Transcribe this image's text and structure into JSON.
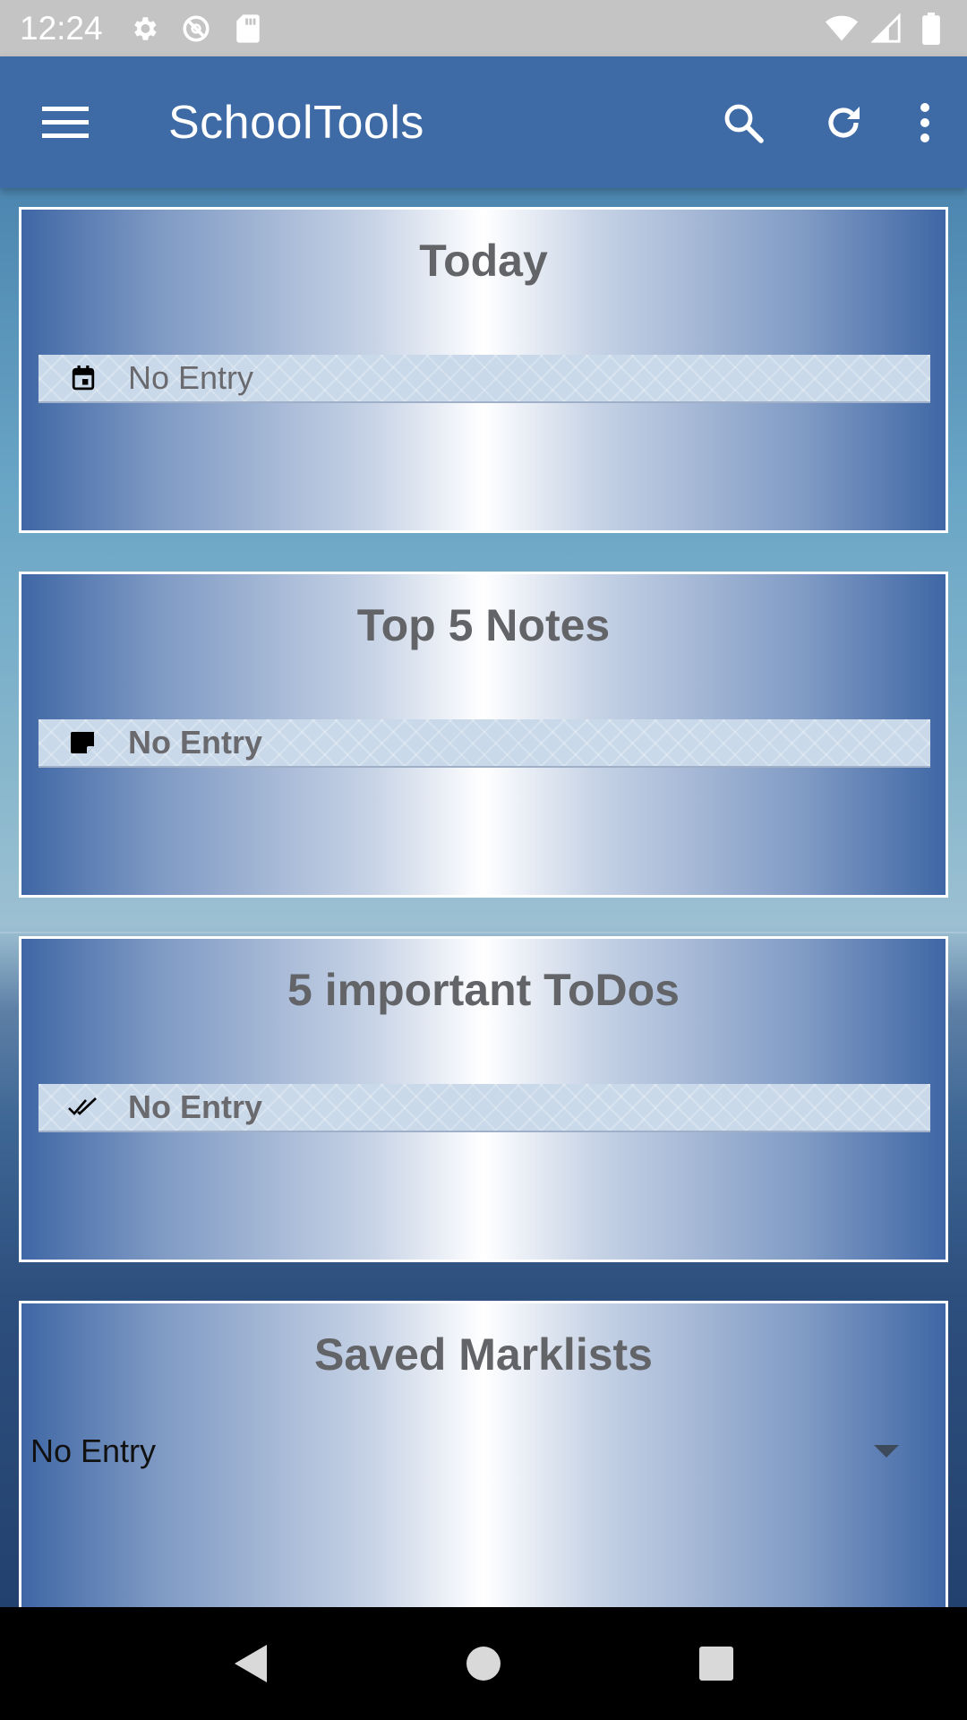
{
  "status_bar": {
    "time": "12:24",
    "left_icons": [
      "settings-icon",
      "no-sync-icon",
      "sd-card-icon"
    ],
    "right_icons": [
      "wifi-icon",
      "signal-icon",
      "battery-icon"
    ]
  },
  "app_bar": {
    "title": "SchoolTools",
    "actions": [
      "search-icon",
      "refresh-icon",
      "more-vert-icon"
    ],
    "color": "#3e6aa6"
  },
  "cards": {
    "today": {
      "title": "Today",
      "entry": "No Entry",
      "icon": "calendar-icon"
    },
    "notes": {
      "title": "Top 5 Notes",
      "entry": "No Entry",
      "icon": "note-icon"
    },
    "todos": {
      "title": "5 important ToDos",
      "entry": "No Entry",
      "icon": "double-check-icon"
    },
    "marklists": {
      "title": "Saved Marklists",
      "selected": "No Entry"
    }
  },
  "nav_bar": {
    "buttons": [
      "back-icon",
      "home-icon",
      "recents-icon"
    ]
  }
}
